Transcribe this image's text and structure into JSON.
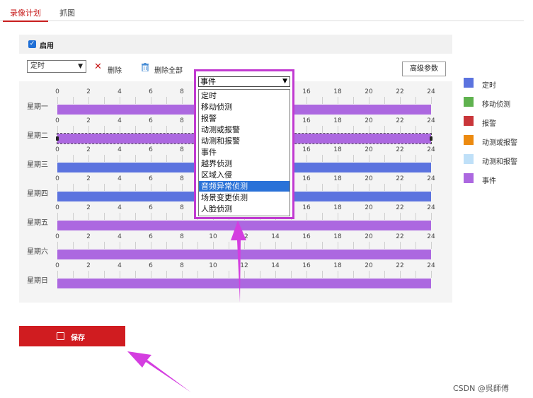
{
  "tabs": [
    {
      "label": "录像计划",
      "active": true
    },
    {
      "label": "抓图",
      "active": false
    }
  ],
  "enable": {
    "label": "启用",
    "checked": true
  },
  "toolbar": {
    "mode_value": "定时",
    "delete_label": "删除",
    "delete_all_label": "删除全部",
    "advanced_label": "高级参数"
  },
  "schedule": {
    "ticks": [
      "0",
      "2",
      "4",
      "6",
      "8",
      "10",
      "12",
      "14",
      "16",
      "18",
      "20",
      "22",
      "24"
    ],
    "days": [
      {
        "label": "星期一",
        "type": "事件"
      },
      {
        "label": "星期二",
        "type": "事件",
        "selected": true
      },
      {
        "label": "星期三",
        "type": "定时"
      },
      {
        "label": "星期四",
        "type": "定时"
      },
      {
        "label": "星期五",
        "type": "事件"
      },
      {
        "label": "星期六",
        "type": "事件"
      },
      {
        "label": "星期日",
        "type": "事件"
      }
    ]
  },
  "legend": [
    {
      "label": "定时",
      "color": "#5b73df"
    },
    {
      "label": "移动侦测",
      "color": "#5fb24f"
    },
    {
      "label": "报警",
      "color": "#c9363a"
    },
    {
      "label": "动测或报警",
      "color": "#ec8a10"
    },
    {
      "label": "动测和报警",
      "color": "#bfe0f8"
    },
    {
      "label": "事件",
      "color": "#ac68e0"
    }
  ],
  "dropdown": {
    "selected": "事件",
    "highlighted": "音频异常侦测",
    "options": [
      "定时",
      "移动侦测",
      "报警",
      "动测或报警",
      "动测和报警",
      "事件",
      "越界侦测",
      "区域入侵",
      "音频异常侦测",
      "场景变更侦测",
      "人脸侦测"
    ]
  },
  "save": {
    "label": "保存"
  },
  "colors": {
    "accent": "#d01c20",
    "annotation": "#c13ad1",
    "highlight": "#2a72d8"
  },
  "watermark": "CSDN @呉師傅"
}
